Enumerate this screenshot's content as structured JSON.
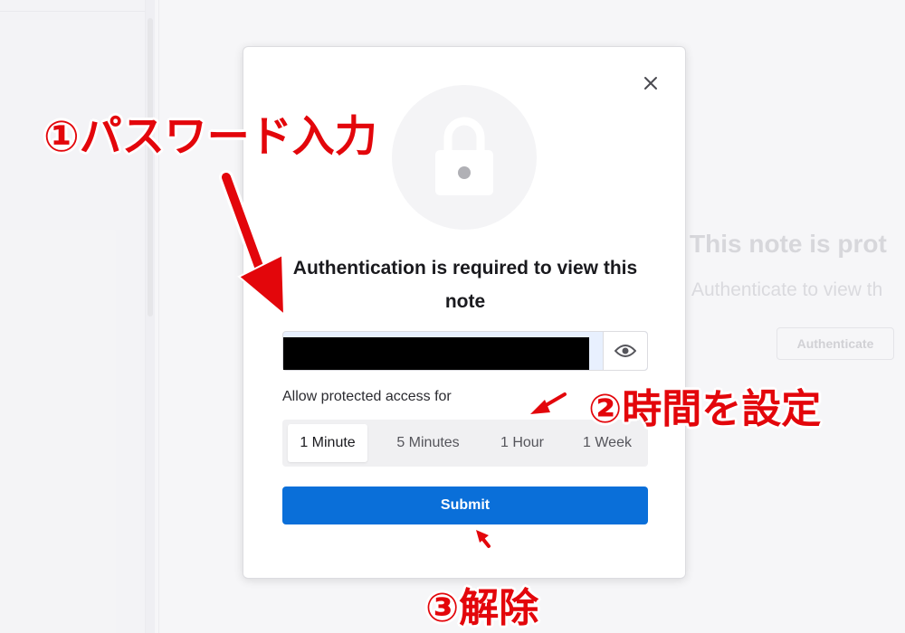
{
  "background": {
    "title": "This note is prot",
    "subtitle": "Authenticate to view th",
    "button_label": "Authenticate"
  },
  "modal": {
    "close_icon": "close-icon",
    "lock_icon": "lock-icon",
    "heading": "Authentication is required to view this note",
    "password": {
      "value": "",
      "masked": true,
      "reveal_icon": "eye-icon"
    },
    "access_label": "Allow protected access for",
    "durations": [
      "1 Minute",
      "5 Minutes",
      "1 Hour",
      "1 Week"
    ],
    "selected_duration": "1 Minute",
    "submit_label": "Submit"
  },
  "annotations": {
    "step1": "①パスワード入力",
    "step2": "②時間を設定",
    "step3": "③解除"
  },
  "colors": {
    "accent": "#0a6fd9",
    "annotation": "#e3060b"
  }
}
